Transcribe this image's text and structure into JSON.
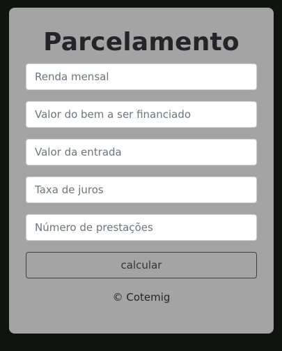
{
  "form": {
    "title": "Parcelamento",
    "fields": [
      {
        "placeholder": "Renda mensal",
        "value": ""
      },
      {
        "placeholder": "Valor do bem a ser financiado",
        "value": ""
      },
      {
        "placeholder": "Valor da entrada",
        "value": ""
      },
      {
        "placeholder": "Taxa de juros",
        "value": ""
      },
      {
        "placeholder": "Número de prestações",
        "value": ""
      }
    ],
    "submit_label": "calcular",
    "footer": "© Cotemig"
  },
  "colors": {
    "page_background": "#111311",
    "card_background": "#a4a4a4",
    "text_dark": "#232529",
    "input_background": "#ffffff",
    "button_border": "#3e3f41"
  }
}
